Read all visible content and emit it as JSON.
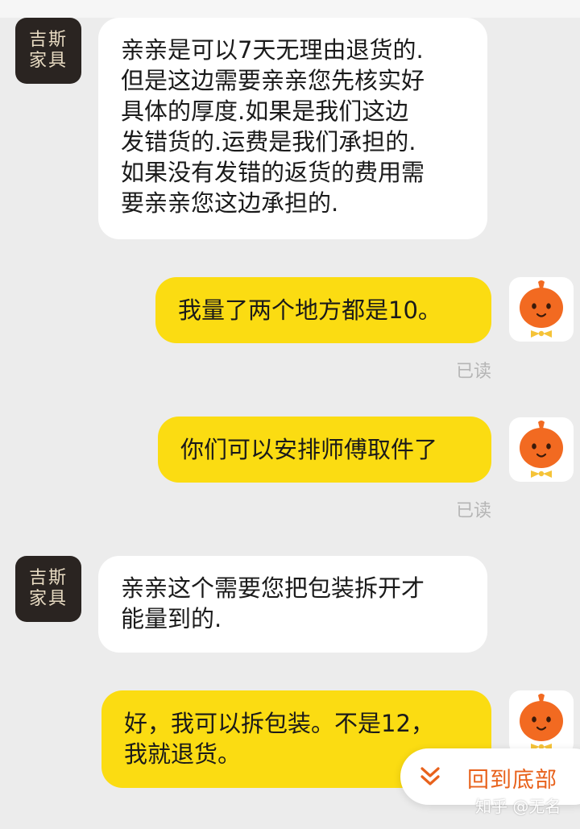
{
  "shop": {
    "avatar_line1": "吉斯",
    "avatar_line2": "家具"
  },
  "messages": [
    {
      "sender": "shop",
      "text": "亲亲是可以7天无理由退货的.\n但是这边需要亲亲您先核实好\n具体的厚度.如果是我们这边\n发错货的.运费是我们承担的.\n如果没有发错的返货的费用需\n要亲亲您这边承担的."
    },
    {
      "sender": "me",
      "text": "我量了两个地方都是10。",
      "status": "已读"
    },
    {
      "sender": "me",
      "text": "你们可以安排师傅取件了",
      "status": "已读"
    },
    {
      "sender": "shop",
      "text": "亲亲这个需要您把包装拆开才\n能量到的."
    },
    {
      "sender": "me",
      "text": "好，我可以拆包装。不是12，\n我就退货。"
    }
  ],
  "scroll_to_bottom": {
    "label": "回到底部",
    "icon": "double-chevron-down-icon"
  },
  "watermark": "知乎 @无名",
  "colors": {
    "my_bubble": "#fbdc12",
    "their_bubble": "#ffffff",
    "background": "#ececec",
    "accent": "#e8621c",
    "avatar_orange": "#f26a21"
  }
}
